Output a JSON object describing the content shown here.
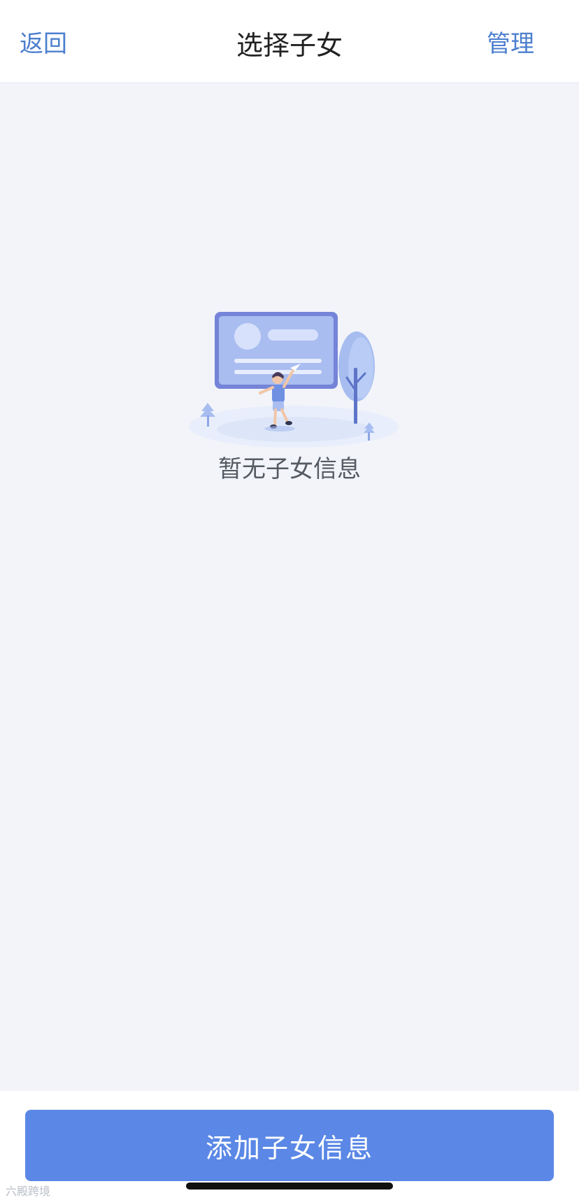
{
  "navbar": {
    "back_label": "返回",
    "title": "选择子女",
    "manage_label": "管理"
  },
  "empty_state": {
    "message": "暂无子女信息",
    "illustration_icon": "empty-children-illustration"
  },
  "footer": {
    "add_button_label": "添加子女信息"
  },
  "watermark": {
    "text": "六殿跨境"
  },
  "colors": {
    "accent": "#5b88e6",
    "nav_link": "#4d7fce",
    "background": "#f2f4f9"
  }
}
